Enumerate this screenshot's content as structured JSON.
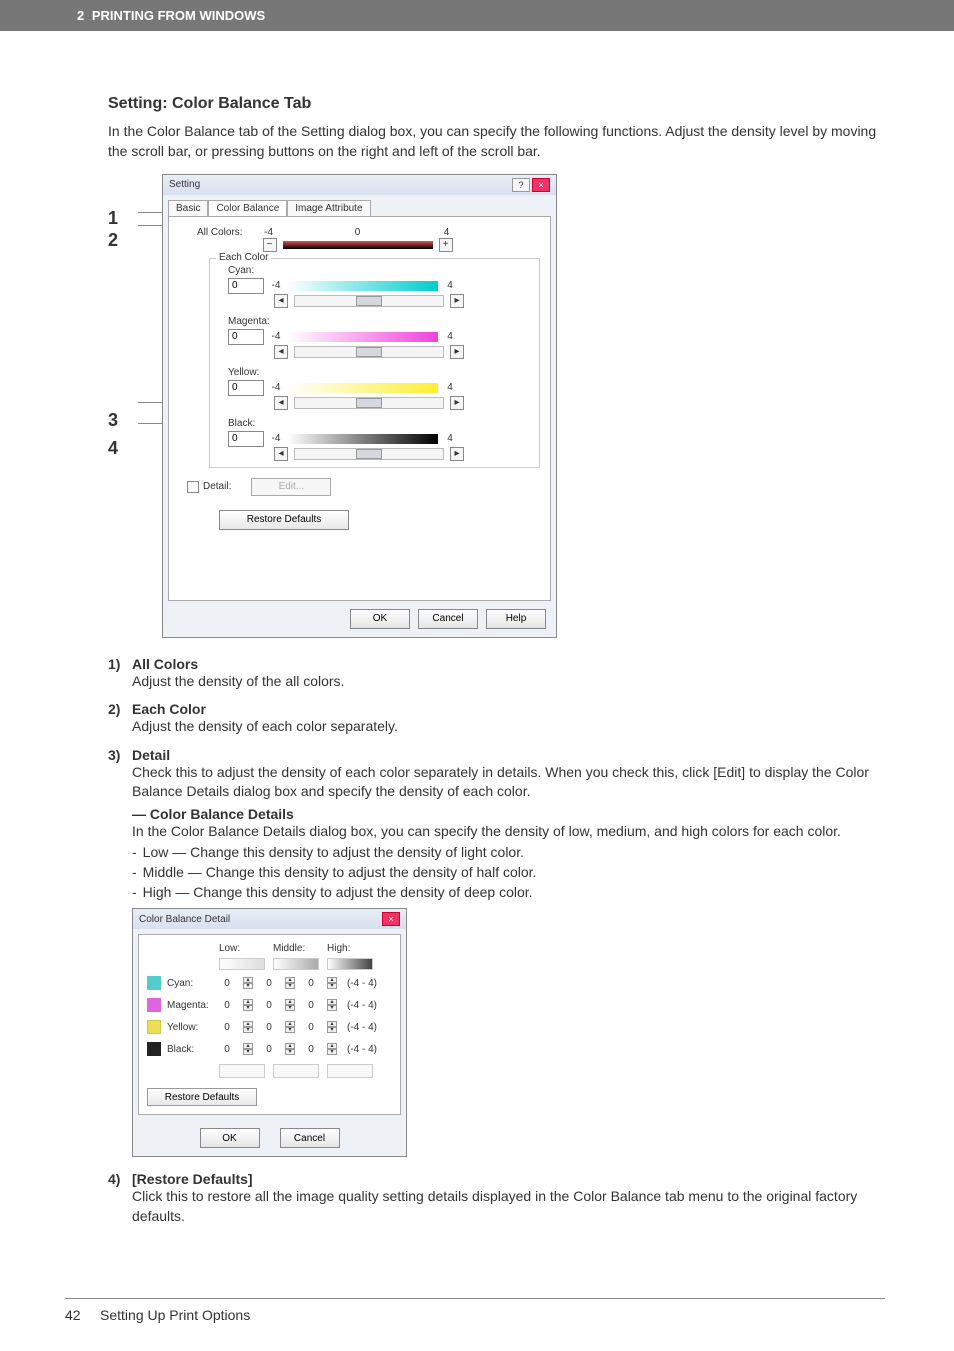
{
  "header": {
    "chapter_number": "2",
    "chapter_title": "PRINTING FROM WINDOWS"
  },
  "section_title": "Setting: Color Balance Tab",
  "intro_text": "In the Color Balance tab of the Setting dialog box, you can specify the following functions. Adjust the density level by moving the scroll bar, or pressing buttons on the right and left of the scroll bar.",
  "callouts": {
    "n1": "1",
    "n2": "2",
    "n3": "3",
    "n4": "4"
  },
  "dialog1": {
    "title": "Setting",
    "tabs": {
      "basic": "Basic",
      "color_balance": "Color Balance",
      "image_attribute": "Image Attribute"
    },
    "all_colors_label": "All Colors:",
    "each_color_label": "Each Color",
    "range_low": "-4",
    "range_zero": "0",
    "range_high": "4",
    "cyan_label": "Cyan:",
    "magenta_label": "Magenta:",
    "yellow_label": "Yellow:",
    "black_label": "Black:",
    "cyan_val": "0",
    "magenta_val": "0",
    "yellow_val": "0",
    "black_val": "0",
    "detail_label": "Detail:",
    "edit_label": "Edit...",
    "restore_label": "Restore Defaults",
    "ok": "OK",
    "cancel": "Cancel",
    "help": "Help"
  },
  "items": {
    "i1": {
      "num": "1)",
      "title": "All Colors",
      "body": "Adjust the density of the all colors."
    },
    "i2": {
      "num": "2)",
      "title": "Each Color",
      "body": "Adjust the density of each color separately."
    },
    "i3": {
      "num": "3)",
      "title": "Detail",
      "body": "Check this to adjust the density of each color separately in details.  When you check this, click [Edit] to display the Color Balance Details dialog box and specify the density of each color.",
      "sub_title": "— Color Balance Details",
      "sub_body": "In the Color Balance Details dialog box, you can specify the density of low, medium, and high colors for each color.",
      "low_line": "Low — Change this density to adjust the density of light color.",
      "mid_line": "Middle — Change this density to adjust the density of half color.",
      "high_line": "High — Change this density to adjust the density of deep color."
    },
    "i4": {
      "num": "4)",
      "title": "[Restore Defaults]",
      "body": "Click this to restore all the image quality setting details displayed in the Color Balance tab menu to the original factory defaults."
    }
  },
  "dialog2": {
    "title": "Color Balance Detail",
    "low": "Low:",
    "middle": "Middle:",
    "high": "High:",
    "cyan": "Cyan:",
    "magenta": "Magenta:",
    "yellow": "Yellow:",
    "black": "Black:",
    "val": "0",
    "range": "(-4 - 4)",
    "restore": "Restore Defaults",
    "ok": "OK",
    "cancel": "Cancel"
  },
  "footer": {
    "page_num": "42",
    "footer_text": "Setting Up Print Options"
  }
}
